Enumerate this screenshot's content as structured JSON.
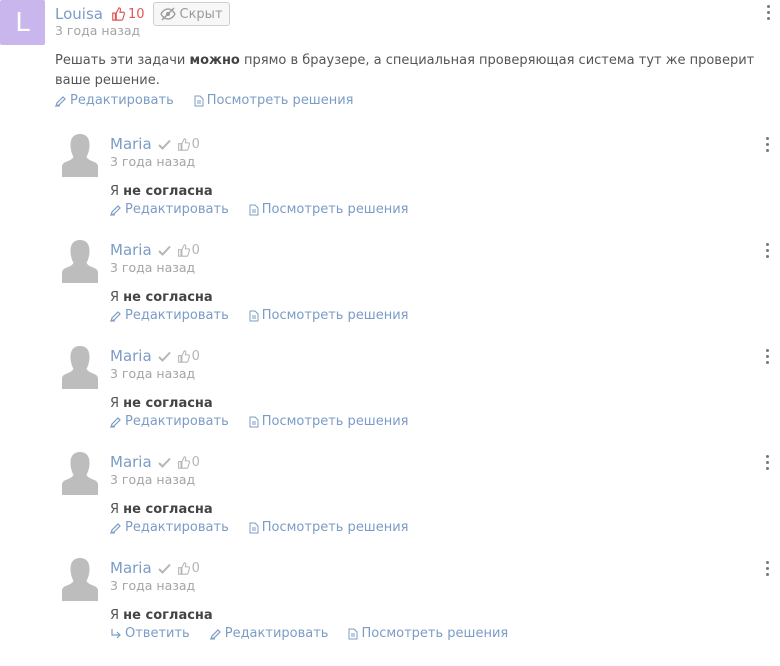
{
  "root": {
    "avatar_letter": "L",
    "author": "Louisa",
    "likes": "10",
    "hidden_label": "Скрыт",
    "time": "3 года назад",
    "text_before": "Решать эти задачи ",
    "text_bold": "можно",
    "text_after": " прямо в браузере, а специальная проверяющая система тут же проверит",
    "text_line2": "ваше решение.",
    "edit_label": "Редактировать",
    "solutions_label": "Посмотреть решения"
  },
  "replies": [
    {
      "author": "Maria",
      "likes": "0",
      "time": "3 года назад",
      "text_prefix": "Я ",
      "text_bold": "не согласна",
      "edit_label": "Редактировать",
      "solutions_label": "Посмотреть решения"
    },
    {
      "author": "Maria",
      "likes": "0",
      "time": "3 года назад",
      "text_prefix": "Я ",
      "text_bold": "не согласна",
      "edit_label": "Редактировать",
      "solutions_label": "Посмотреть решения"
    },
    {
      "author": "Maria",
      "likes": "0",
      "time": "3 года назад",
      "text_prefix": "Я ",
      "text_bold": "не согласна",
      "edit_label": "Редактировать",
      "solutions_label": "Посмотреть решения"
    },
    {
      "author": "Maria",
      "likes": "0",
      "time": "3 года назад",
      "text_prefix": "Я ",
      "text_bold": "не согласна",
      "edit_label": "Редактировать",
      "solutions_label": "Посмотреть решения"
    },
    {
      "author": "Maria",
      "likes": "0",
      "time": "3 года назад",
      "text_prefix": "Я ",
      "text_bold": "не согласна",
      "reply_label": "Ответить",
      "edit_label": "Редактировать",
      "solutions_label": "Посмотреть решения"
    }
  ],
  "icons": {
    "like": "thumbs-up-icon",
    "verified": "checkmark-icon",
    "edit": "pencil-icon",
    "solutions": "document-icon",
    "reply": "reply-arrow-icon",
    "menu": "kebab-menu-icon",
    "hidden": "eye-slash-icon"
  },
  "colors": {
    "accent": "#7b9cc6",
    "like_active": "#e05454",
    "avatar": "#c9b6ec"
  }
}
